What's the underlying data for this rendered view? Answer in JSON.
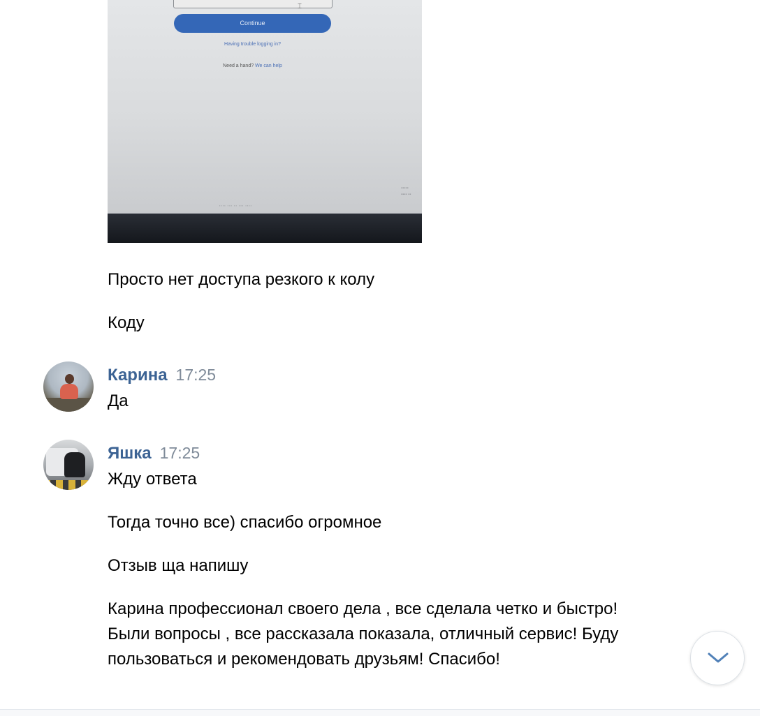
{
  "attachment": {
    "screen": {
      "continue_label": "Continue",
      "trouble_link": "Having trouble logging in?",
      "help_prefix": "Need a hand?",
      "help_link": "We can help"
    }
  },
  "messages": [
    {
      "text": "Просто нет доступа резкого к колу"
    },
    {
      "text": "Коду"
    }
  ],
  "groups": [
    {
      "author": "Карина",
      "time": "17:25",
      "avatar_icon": "user-avatar-photo",
      "messages": [
        "Да"
      ]
    },
    {
      "author": "Яшка",
      "time": "17:25",
      "avatar_icon": "user-avatar-photo",
      "messages": [
        "Жду ответа",
        "Тогда точно все) спасибо огромное",
        "Отзыв ща напишу",
        "Карина профессионал своего дела , все сделала четко и быстро! Были вопросы , все рассказала показала, отличный сервис! Буду пользоваться и рекомендовать друзьям! Спасибо!"
      ]
    }
  ],
  "scroll_button": {
    "icon": "chevron-down-icon"
  },
  "colors": {
    "author_name": "#3c6394",
    "timestamp": "#7f8b99",
    "text": "#000000",
    "background": "#ffffff"
  }
}
